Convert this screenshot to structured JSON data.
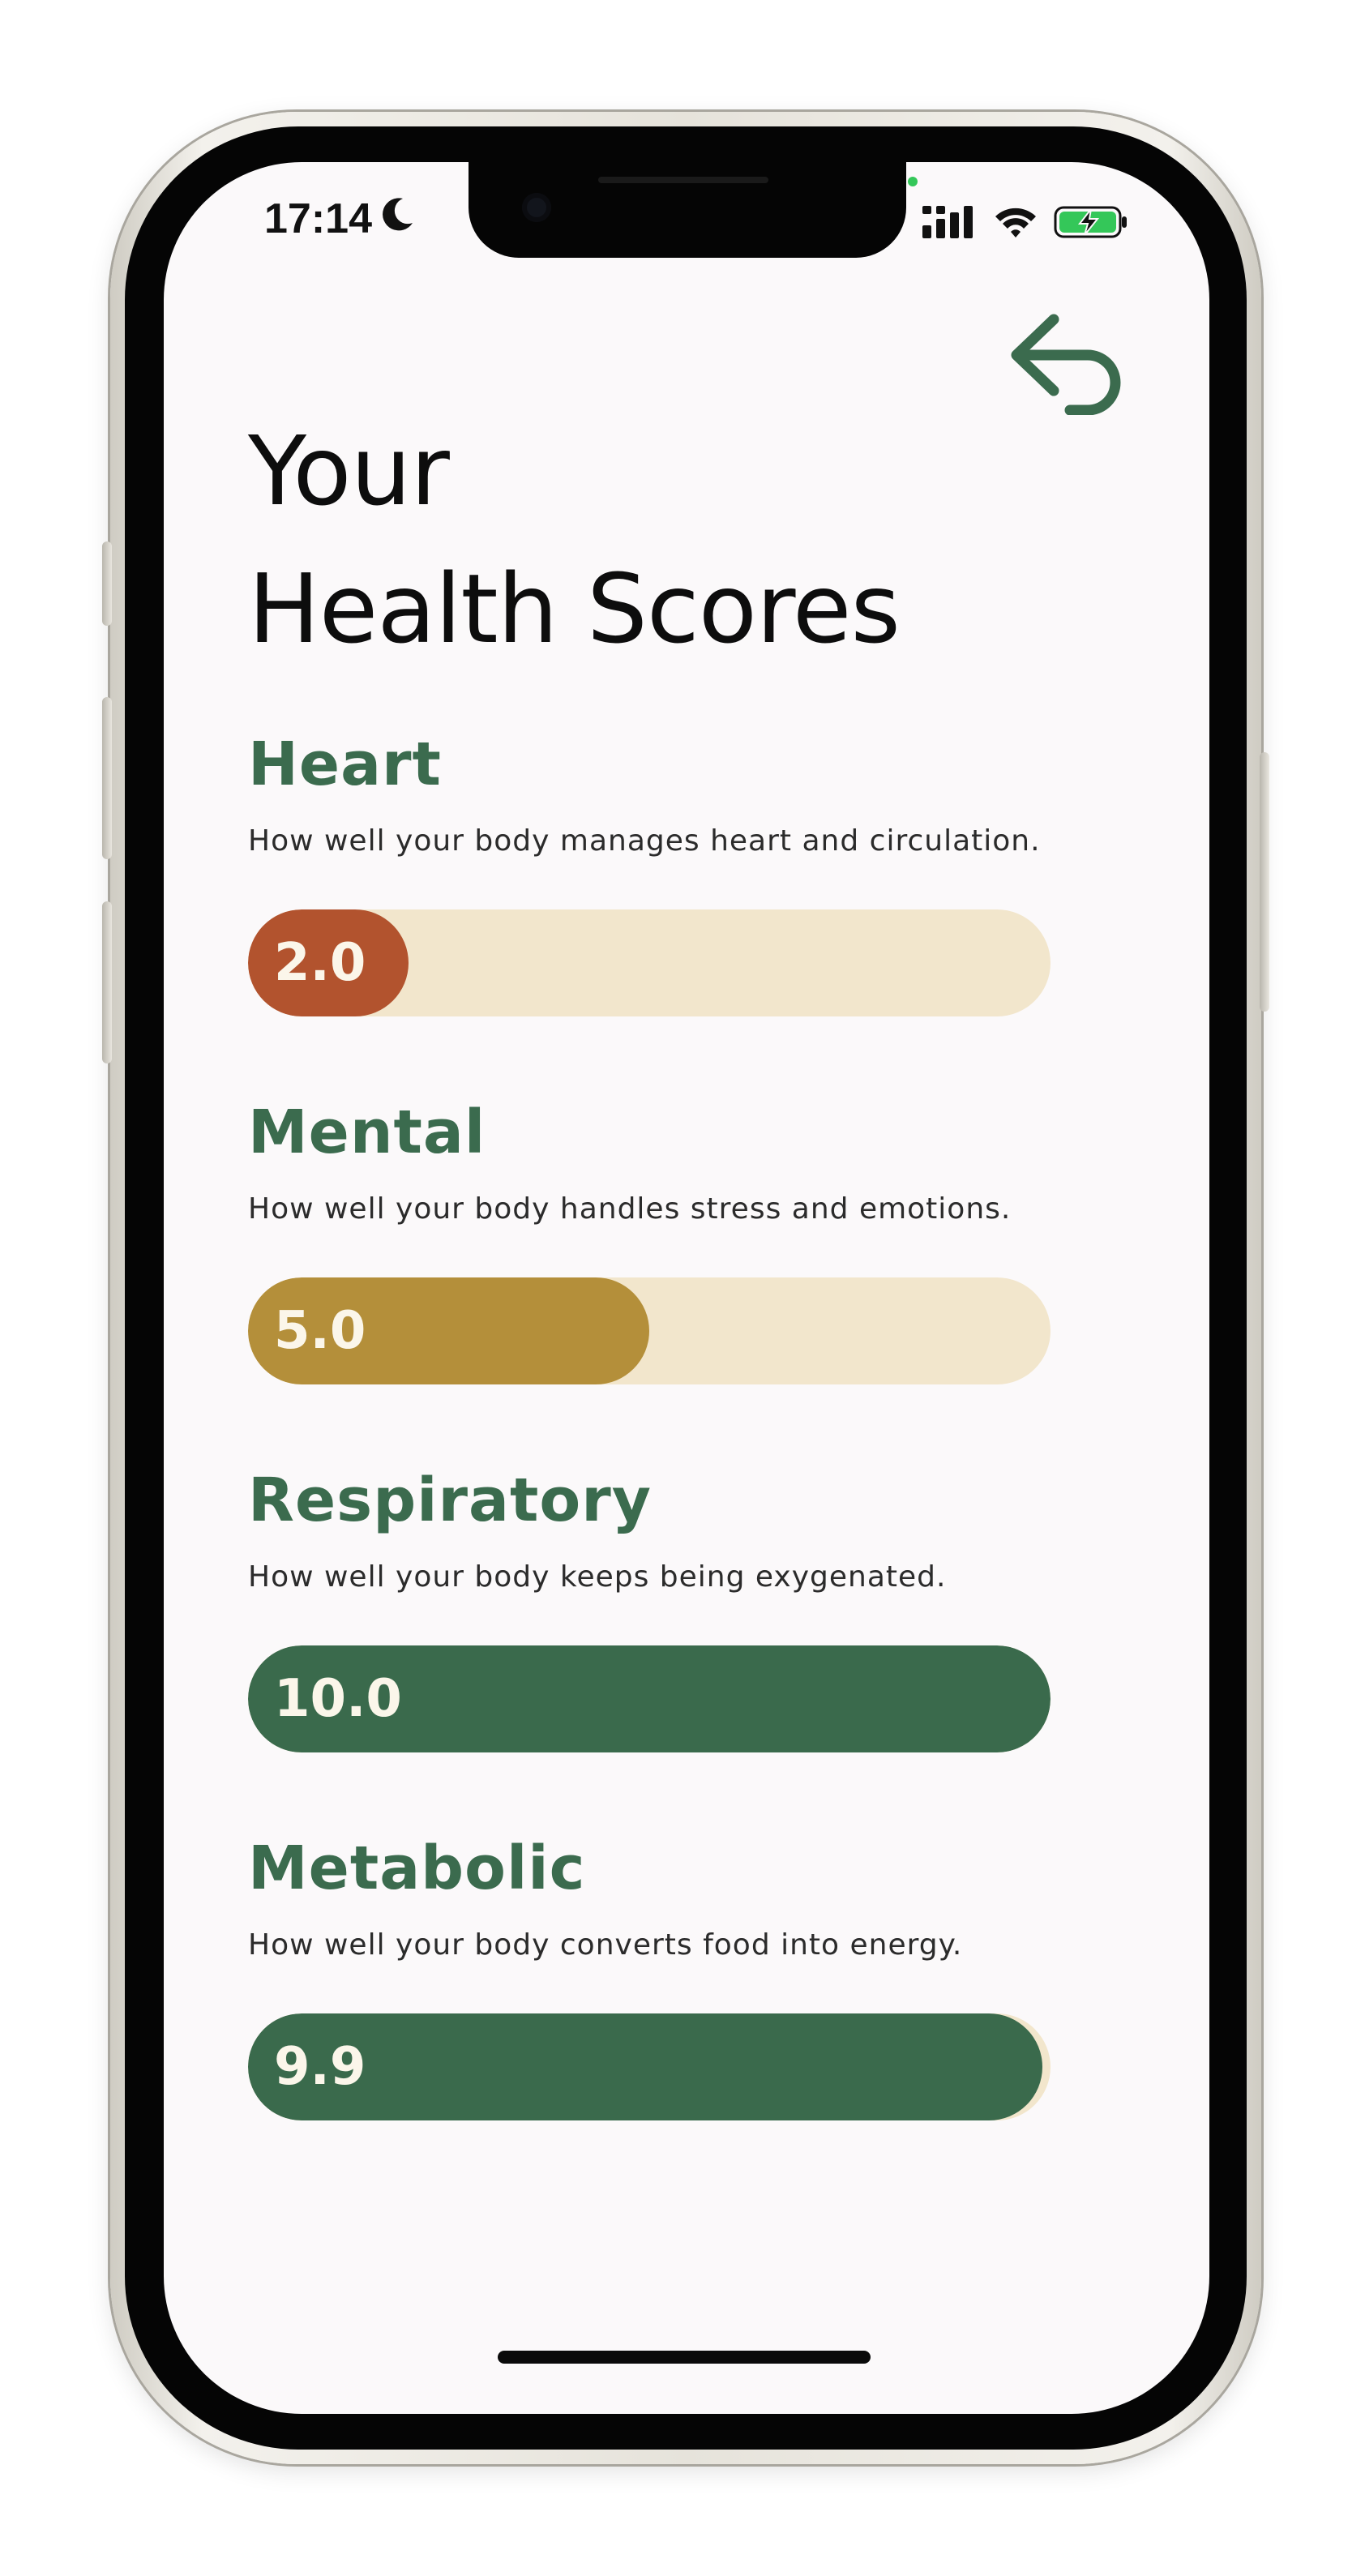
{
  "status_bar": {
    "time": "17:14",
    "icons": [
      "moon-icon",
      "cellular-signal-icon",
      "wifi-icon",
      "battery-charging-icon"
    ]
  },
  "header": {
    "title_line1": "Your",
    "title_line2": "Health Scores",
    "back_icon": "back-arrow-icon"
  },
  "colors": {
    "accent_green": "#3b6b4e",
    "bar_track": "#f2e6cc",
    "low_red": "#b2532e",
    "mid_gold": "#b48f3a",
    "high_green": "#3a6a4c"
  },
  "scores": [
    {
      "name": "Heart",
      "description": "How well your body manages heart and circulation.",
      "value_label": "2.0",
      "fraction": 0.2,
      "color": "#b2532e"
    },
    {
      "name": "Mental",
      "description": "How well your body handles stress and emotions.",
      "value_label": "5.0",
      "fraction": 0.5,
      "color": "#b48f3a"
    },
    {
      "name": "Respiratory",
      "description": "How well your body keeps being exygenated.",
      "value_label": "10.0",
      "fraction": 1.0,
      "color": "#3a6a4c"
    },
    {
      "name": "Metabolic",
      "description": "How well your body converts food into energy.",
      "value_label": "9.9",
      "fraction": 0.99,
      "color": "#3a6a4c"
    }
  ]
}
